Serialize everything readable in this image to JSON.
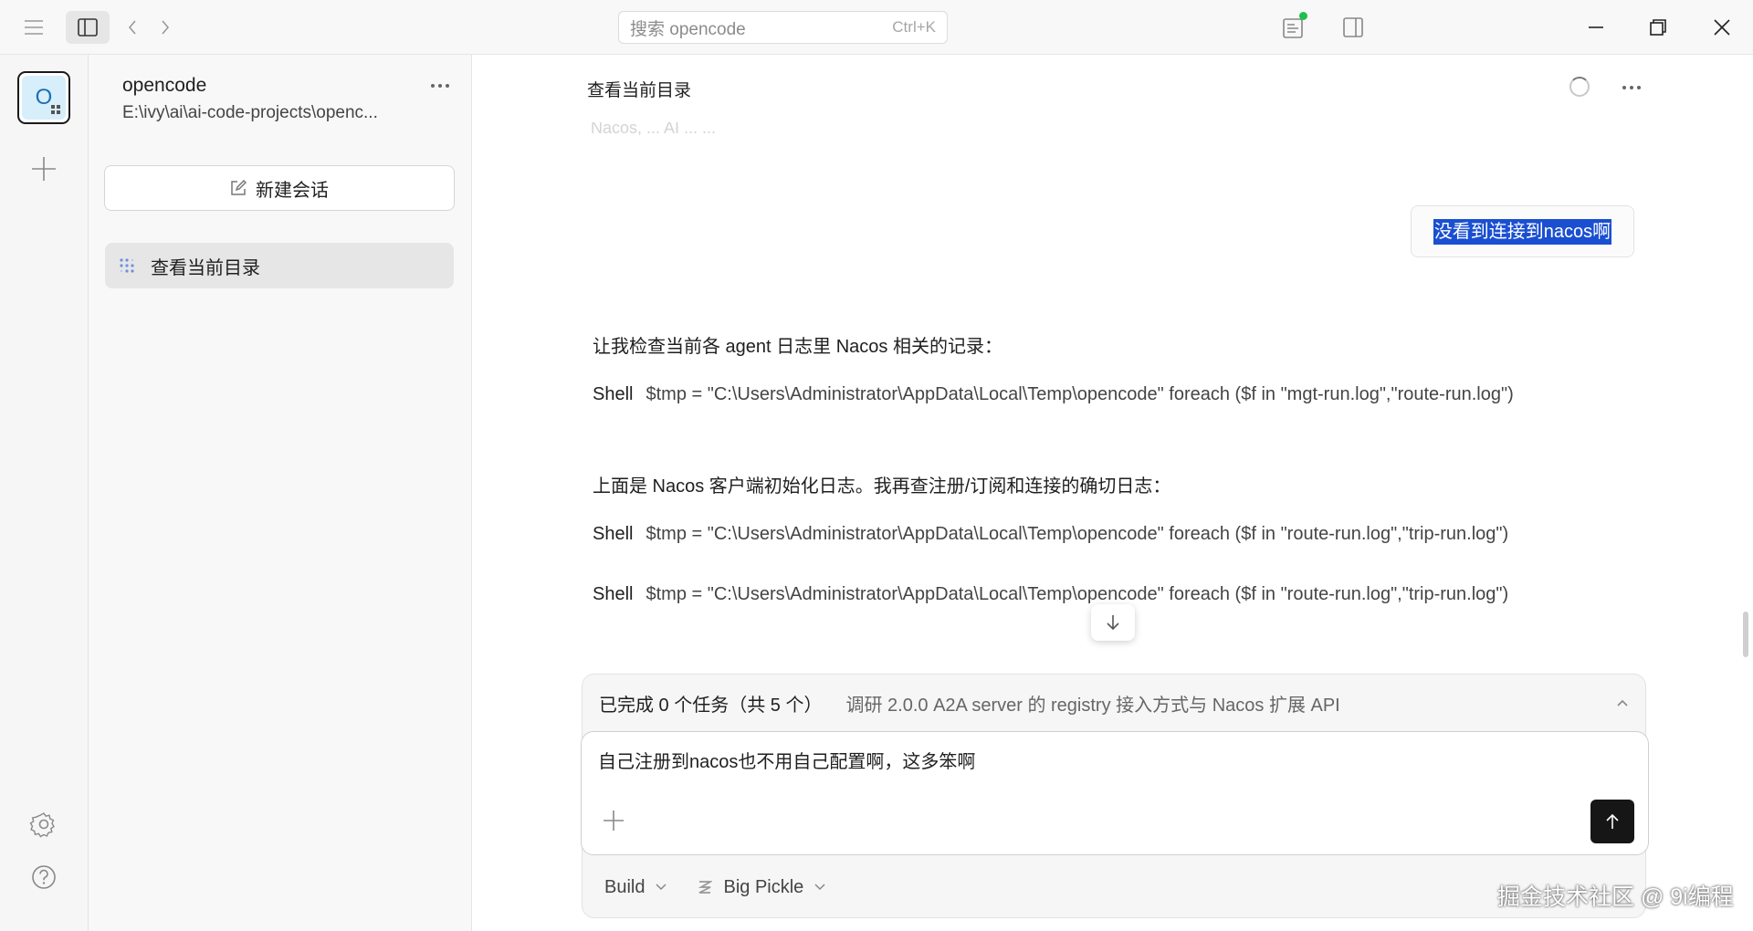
{
  "titlebar": {
    "search_placeholder": "搜索 opencode",
    "search_shortcut": "Ctrl+K"
  },
  "rail": {
    "project_initial": "O"
  },
  "sidebar": {
    "project_name": "opencode",
    "project_path": "E:\\ivy\\ai\\ai-code-projects\\openc...",
    "new_session_label": "新建会话",
    "sessions": [
      {
        "title": "查看当前目录"
      }
    ]
  },
  "main": {
    "title": "查看当前目录",
    "faded_text": "Nacos, ... AI ... ...",
    "user_message": "没看到连接到nacos啊",
    "messages": [
      {
        "text": "让我检查当前各 agent 日志里 Nacos 相关的记录："
      },
      {
        "tool": "Shell",
        "cmd": "$tmp = \"C:\\Users\\Administrator\\AppData\\Local\\Temp\\opencode\" foreach ($f in \"mgt-run.log\",\"route-run.log\")"
      },
      {
        "text": "上面是 Nacos 客户端初始化日志。我再查注册/订阅和连接的确切日志："
      },
      {
        "tool": "Shell",
        "cmd": "$tmp = \"C:\\Users\\Administrator\\AppData\\Local\\Temp\\opencode\" foreach ($f in \"route-run.log\",\"trip-run.log\")"
      },
      {
        "tool": "Shell",
        "cmd": "$tmp = \"C:\\Users\\Administrator\\AppData\\Local\\Temp\\opencode\" foreach ($f in \"route-run.log\",\"trip-run.log\")"
      }
    ]
  },
  "composer": {
    "task_count": "已完成 0 个任务（共 5 个）",
    "task_desc": "调研 2.0.0 A2A server 的 registry 接入方式与 Nacos 扩展 API",
    "input_value": "自己注册到nacos也不用自己配置啊，这多笨啊",
    "mode": "Build",
    "model": "Big Pickle"
  },
  "watermark": "掘金技术社区 @ 9i编程"
}
